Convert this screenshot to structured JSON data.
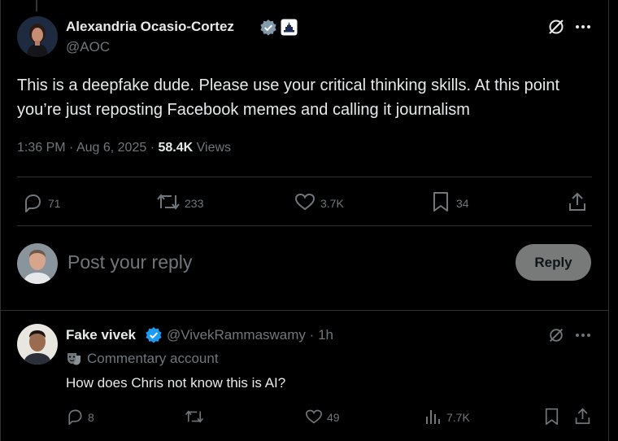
{
  "colors": {
    "background": "#000000",
    "text_primary": "#e7e9ea",
    "text_secondary": "#71767b",
    "verified_gray": "#829aab",
    "verified_blue": "#1d9bf0",
    "reply_button_bg": "#787a7a"
  },
  "main_post": {
    "author_name": "Alexandria Ocasio-Cortez",
    "handle": "@AOC",
    "badge_icon": "verified-gray-badge-icon",
    "affiliation_icon": "capitol-affiliation-icon",
    "text": "This is a deepfake dude. Please use your critical thinking skills. At this point you’re just reposting Facebook memes and calling it journalism",
    "time": "1:36 PM",
    "separator": "·",
    "date": "Aug 6, 2025",
    "views_count": "58.4K",
    "views_label": "Views",
    "actions": {
      "replies": "71",
      "reposts": "233",
      "likes": "3.7K",
      "bookmarks": "34"
    }
  },
  "composer": {
    "placeholder": "Post your reply",
    "button_label": "Reply"
  },
  "reply_post": {
    "author_name": "Fake vivek",
    "handle": "@VivekRammaswamy",
    "separator": "·",
    "age": "1h",
    "commentary_label": "Commentary account",
    "text": "How does Chris not know this is AI?",
    "actions": {
      "replies": "8",
      "likes": "49",
      "views": "7.7K"
    }
  }
}
